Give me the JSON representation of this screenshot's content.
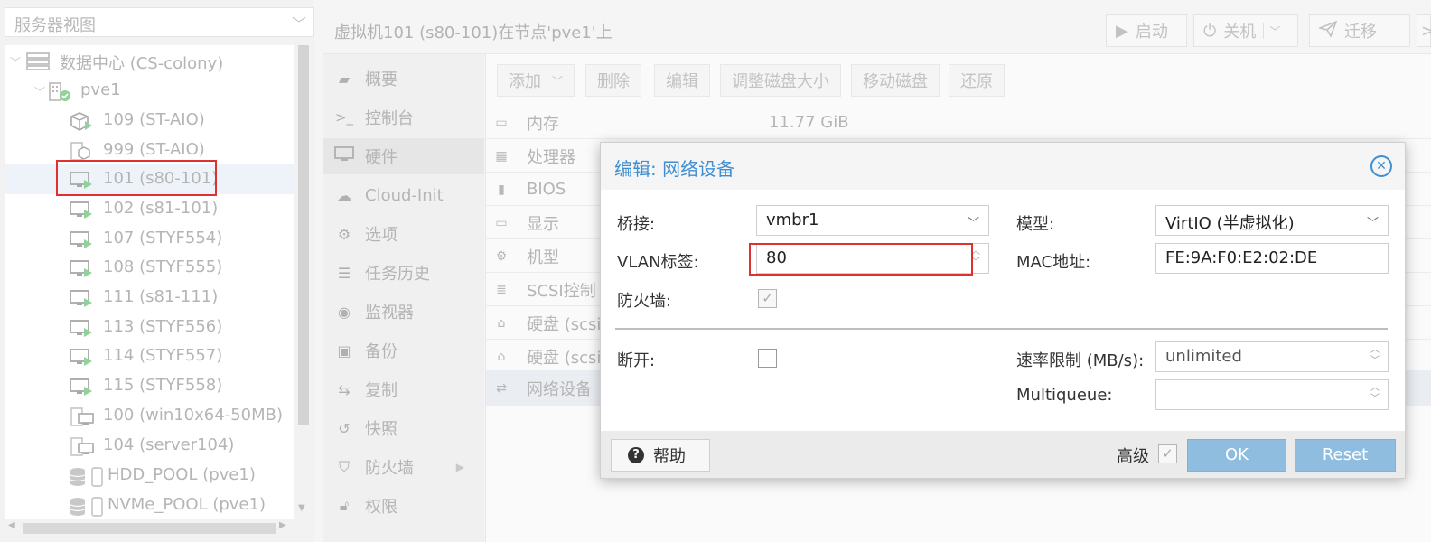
{
  "tree": {
    "view_label": "服务器视图",
    "items": [
      {
        "label": "数据中心 (CS-colony)",
        "type": "datacenter"
      },
      {
        "label": "pve1",
        "type": "node"
      },
      {
        "label": "109 (ST-AIO)",
        "type": "ct-running"
      },
      {
        "label": "999 (ST-AIO)",
        "type": "ct-template"
      },
      {
        "label": "101 (s80-101)",
        "type": "vm-running"
      },
      {
        "label": "102 (s81-101)",
        "type": "vm-running"
      },
      {
        "label": "107 (STYF554)",
        "type": "vm-running"
      },
      {
        "label": "108 (STYF555)",
        "type": "vm-running"
      },
      {
        "label": "111 (s81-111)",
        "type": "vm-running"
      },
      {
        "label": "113 (STYF556)",
        "type": "vm-running"
      },
      {
        "label": "114 (STYF557)",
        "type": "vm-running"
      },
      {
        "label": "115 (STYF558)",
        "type": "vm-running"
      },
      {
        "label": "100 (win10x64-50MB)",
        "type": "vm-template"
      },
      {
        "label": "104 (server104)",
        "type": "vm-template"
      },
      {
        "label": "HDD_POOL (pve1)",
        "type": "storage"
      },
      {
        "label": "NVMe_POOL (pve1)",
        "type": "storage"
      }
    ]
  },
  "vm": {
    "title": "虚拟机101 (s80-101)在节点'pve1'上",
    "buttons": {
      "start": "启动",
      "shutdown": "关机",
      "migrate": "迁移"
    }
  },
  "nav": [
    {
      "label": "概要",
      "icon": "book-icon"
    },
    {
      "label": "控制台",
      "icon": "terminal-icon"
    },
    {
      "label": "硬件",
      "icon": "monitor-icon"
    },
    {
      "label": "Cloud-Init",
      "icon": "cloud-icon"
    },
    {
      "label": "选项",
      "icon": "gear-icon"
    },
    {
      "label": "任务历史",
      "icon": "list-icon"
    },
    {
      "label": "监视器",
      "icon": "eye-icon"
    },
    {
      "label": "备份",
      "icon": "floppy-icon"
    },
    {
      "label": "复制",
      "icon": "retweet-icon"
    },
    {
      "label": "快照",
      "icon": "history-icon"
    },
    {
      "label": "防火墙",
      "icon": "shield-icon"
    },
    {
      "label": "权限",
      "icon": "unlock-icon"
    }
  ],
  "toolbar": {
    "add": "添加",
    "remove": "删除",
    "edit": "编辑",
    "resize": "调整磁盘大小",
    "move": "移动磁盘",
    "revert": "还原"
  },
  "hardware": [
    {
      "label": "内存",
      "value": "11.77 GiB",
      "icon": "memory-icon"
    },
    {
      "label": "处理器",
      "value": "",
      "icon": "cpu-icon"
    },
    {
      "label": "BIOS",
      "value": "",
      "icon": "microchip-icon"
    },
    {
      "label": "显示",
      "value": "",
      "icon": "desktop-icon"
    },
    {
      "label": "机型",
      "value": "",
      "icon": "cogs-icon"
    },
    {
      "label": "SCSI控制",
      "value": "",
      "icon": "database-icon"
    },
    {
      "label": "硬盘 (scsi",
      "value": "",
      "icon": "hdd-icon"
    },
    {
      "label": "硬盘 (scsi",
      "value": "",
      "icon": "hdd-icon"
    },
    {
      "label": "网络设备",
      "value": "",
      "icon": "exchange-icon"
    }
  ],
  "dialog": {
    "title": "编辑: 网络设备",
    "bridge": {
      "label": "桥接:",
      "value": "vmbr1"
    },
    "vlan": {
      "label": "VLAN标签:",
      "value": "80"
    },
    "firewall": {
      "label": "防火墙:",
      "checked": true
    },
    "model": {
      "label": "模型:",
      "value": "VirtIO (半虚拟化)"
    },
    "mac": {
      "label": "MAC地址:",
      "value": "FE:9A:F0:E2:02:DE"
    },
    "disconnect": {
      "label": "断开:",
      "checked": false
    },
    "rate": {
      "label": "速率限制 (MB/s):",
      "value": "unlimited"
    },
    "multiqueue": {
      "label": "Multiqueue:",
      "value": ""
    },
    "help": "帮助",
    "advanced": {
      "label": "高级",
      "checked": true
    },
    "ok": "OK",
    "reset": "Reset"
  }
}
